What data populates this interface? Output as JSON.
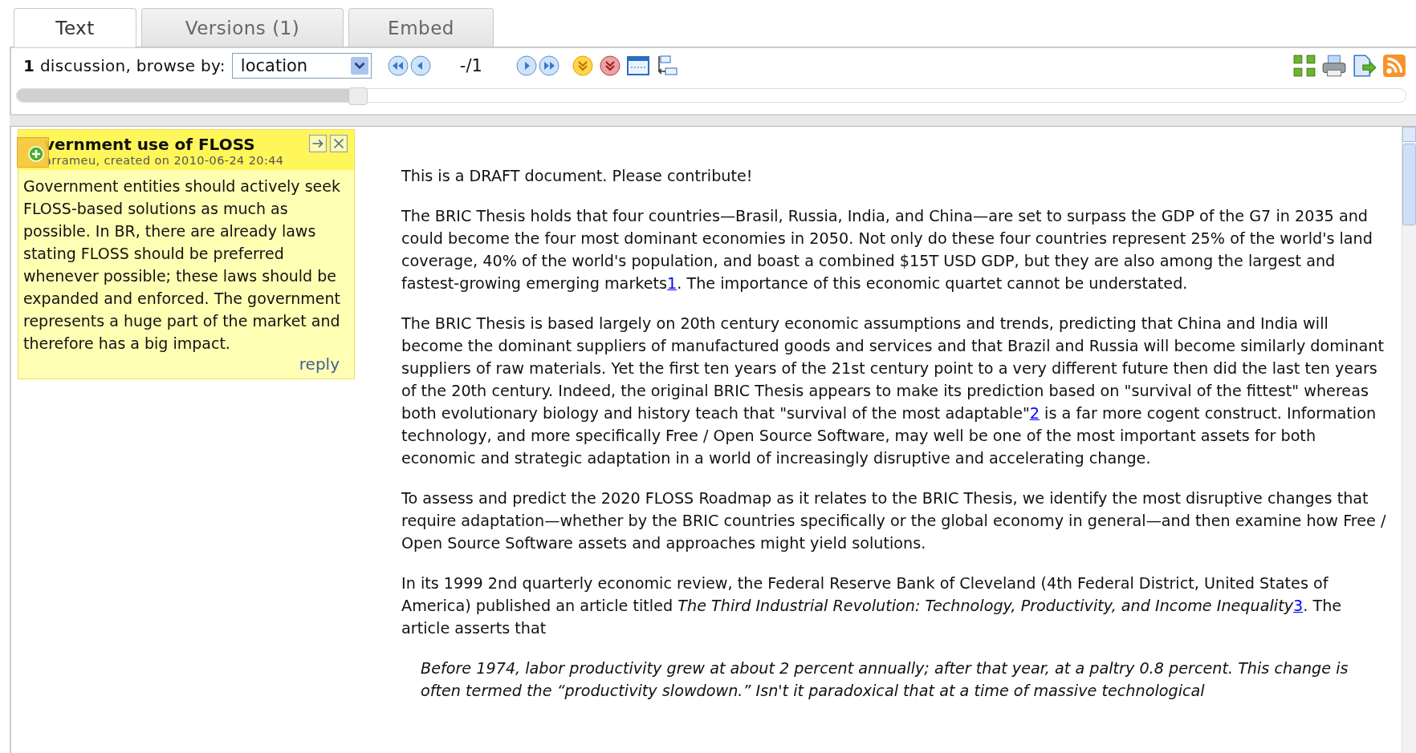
{
  "tabs": [
    {
      "label": "Text",
      "selected": true
    },
    {
      "label": "Versions (1)",
      "selected": false
    },
    {
      "label": "Embed",
      "selected": false
    }
  ],
  "toolbar": {
    "count": "1",
    "count_label": "discussion, browse by:",
    "browse_by": "location",
    "position": "-/1",
    "slider": {
      "level": 0.245
    }
  },
  "comment": {
    "title": "vernment use of FLOSS",
    "meta": "arrameu, created on 2010-06-24 20:44",
    "body": "Government entities should actively seek FLOSS-based solutions as much as possible. In BR, there are already laws stating FLOSS should be preferred whenever possible; these laws should be expanded and enforced. The government represents a huge part of the market and therefore has a big impact.",
    "reply": "reply"
  },
  "document": {
    "paragraphs": [
      {
        "kind": "normal",
        "parts": [
          {
            "kind": "text",
            "text": "This is a DRAFT document. Please contribute!"
          }
        ]
      },
      {
        "kind": "normal",
        "parts": [
          {
            "kind": "text",
            "text": "The BRIC Thesis holds that four countries—Brasil, Russia, India, and China—are set to surpass the GDP of the G7 in 2035 and could become the four most dominant economies in 2050. Not only do these four countries represent 25% of the world's land coverage, 40% of the world's population, and boast a combined $15T USD GDP, but they are also among the largest and fastest-growing emerging markets"
          },
          {
            "kind": "link",
            "text": "1"
          },
          {
            "kind": "text",
            "text": ". The importance of this economic quartet cannot be understated."
          }
        ]
      },
      {
        "kind": "normal",
        "parts": [
          {
            "kind": "text",
            "text": "The BRIC Thesis is based largely on 20th century economic assumptions and trends, predicting that China and India will become the dominant suppliers of manufactured goods and services and that Brazil and Russia will become similarly dominant suppliers of raw materials. Yet the first ten years of the 21st century point to a very different future then did the last ten years of the 20th century. Indeed, the original BRIC Thesis appears to make its prediction based on \"survival of the fittest\" whereas both evolutionary biology and history teach that \"survival of the most adaptable\""
          },
          {
            "kind": "link",
            "text": "2"
          },
          {
            "kind": "text",
            "text": " is a far more cogent construct. Information technology, and more specifically Free / Open Source Software, may well be one of the most important assets for both economic and strategic adaptation in a world of increasingly disruptive and accelerating change."
          }
        ]
      },
      {
        "kind": "normal",
        "parts": [
          {
            "kind": "text",
            "text": "To assess and predict the 2020 FLOSS Roadmap as it relates to the BRIC Thesis, we identify the most disruptive changes that require adaptation—whether by the BRIC countries specifically or the global economy in general—and then examine how Free / Open Source Software assets and approaches might yield solutions."
          }
        ]
      },
      {
        "kind": "normal",
        "parts": [
          {
            "kind": "text",
            "text": "In its 1999 2nd quarterly economic review, the Federal Reserve Bank of Cleveland (4th Federal District, United States of America) published an article titled "
          },
          {
            "kind": "italic",
            "text": "The Third Industrial Revolution: Technology, Productivity, and Income Inequality"
          },
          {
            "kind": "link",
            "text": "3"
          },
          {
            "kind": "text",
            "text": ". The article asserts that"
          }
        ]
      },
      {
        "kind": "quote",
        "parts": [
          {
            "kind": "text",
            "text": "Before 1974, labor productivity grew at about 2 percent annually; after that year, at a paltry 0.8 percent. This change is often termed the “productivity slowdown.” Isn't it paradoxical that at a time of massive technological"
          }
        ]
      }
    ]
  }
}
